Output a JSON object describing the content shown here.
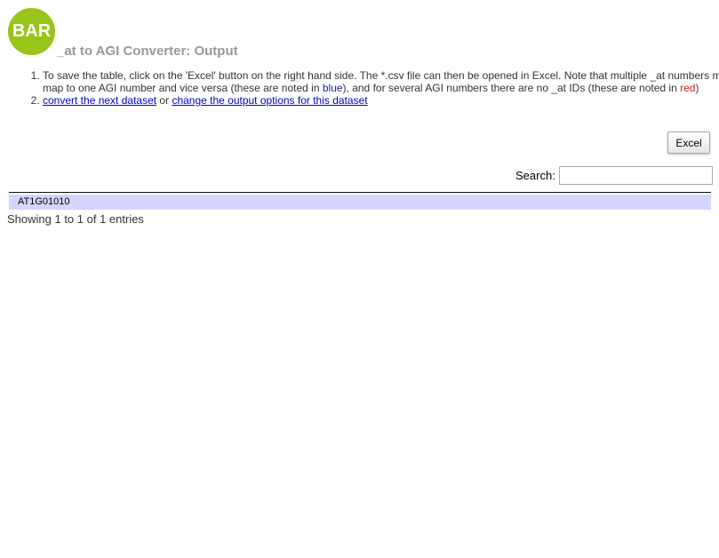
{
  "logo": {
    "text": "BAR"
  },
  "header": {
    "title": "_at to AGI Converter: Output"
  },
  "instructions": {
    "item1": {
      "text_before": "To save the table, click on the 'Excel' button on the right hand side. The *.csv file can then be opened in Excel. Note that multiple _at numbers may map to one AGI number and vice versa (these are noted in ",
      "blue_word": "blue",
      "text_middle": "), and for several AGI numbers there are no _at IDs (these are noted in ",
      "red_word": "red",
      "text_after": ")"
    },
    "item2": {
      "link_next": "convert the next dataset",
      "or_text": " or ",
      "link_options": "change the output options for this dataset"
    }
  },
  "colors": {
    "logo_green": "#97c51a",
    "title_gray": "#999999",
    "row_highlight": "#d4d6ff",
    "multiple_mapping_blue": "#1a1aa6",
    "no_id_red": "#cc2222"
  },
  "toolbar": {
    "excel_label": "Excel"
  },
  "search": {
    "label": "Search:",
    "value": "",
    "placeholder": ""
  },
  "table": {
    "rows": [
      {
        "cells": [
          "AT1G01010"
        ]
      }
    ]
  },
  "info": {
    "text": "Showing 1 to 1 of 1 entries"
  }
}
